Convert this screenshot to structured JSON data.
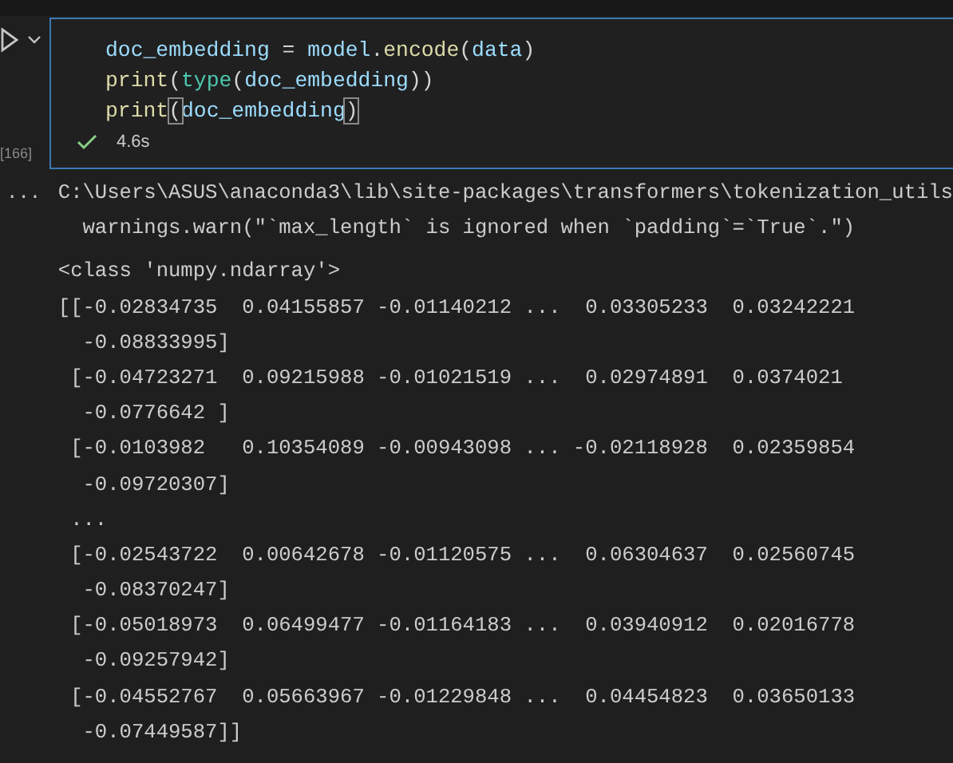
{
  "cell": {
    "execution_count": "[166]",
    "status": {
      "kind": "success",
      "duration": "4.6s"
    },
    "code_lines": [
      [
        {
          "kind": "variable",
          "text": "doc_embedding"
        },
        {
          "kind": "plain",
          "text": " = "
        },
        {
          "kind": "variable",
          "text": "model"
        },
        {
          "kind": "plain",
          "text": "."
        },
        {
          "kind": "function",
          "text": "encode"
        },
        {
          "kind": "plain",
          "text": "("
        },
        {
          "kind": "variable",
          "text": "data"
        },
        {
          "kind": "plain",
          "text": ")"
        }
      ],
      [
        {
          "kind": "function",
          "text": "print"
        },
        {
          "kind": "plain",
          "text": "("
        },
        {
          "kind": "builtin",
          "text": "type"
        },
        {
          "kind": "plain",
          "text": "("
        },
        {
          "kind": "variable",
          "text": "doc_embedding"
        },
        {
          "kind": "plain",
          "text": "))"
        }
      ],
      [
        {
          "kind": "function",
          "text": "print"
        },
        {
          "kind": "bracket",
          "text": "("
        },
        {
          "kind": "variable",
          "text": "doc_embedding"
        },
        {
          "kind": "bracket",
          "text": ")"
        }
      ]
    ]
  },
  "output": {
    "marker": "...",
    "lines": [
      "C:\\Users\\ASUS\\anaconda3\\lib\\site-packages\\transformers\\tokenization_utils",
      "  warnings.warn(\"`max_length` is ignored when `padding`=`True`.\")",
      "<class 'numpy.ndarray'>",
      "[[-0.02834735  0.04155857 -0.01140212 ...  0.03305233  0.03242221",
      "  -0.08833995]",
      " [-0.04723271  0.09215988 -0.01021519 ...  0.02974891  0.0374021",
      "  -0.0776642 ]",
      " [-0.0103982   0.10354089 -0.00943098 ... -0.02118928  0.02359854",
      "  -0.09720307]",
      " ...",
      " [-0.02543722  0.00642678 -0.01120575 ...  0.06304637  0.02560745",
      "  -0.08370247]",
      " [-0.05018973  0.06499477 -0.01164183 ...  0.03940912  0.02016778",
      "  -0.09257942]",
      " [-0.04552767  0.05663967 -0.01229848 ...  0.04454823  0.03650133",
      "  -0.07449587]]"
    ]
  }
}
